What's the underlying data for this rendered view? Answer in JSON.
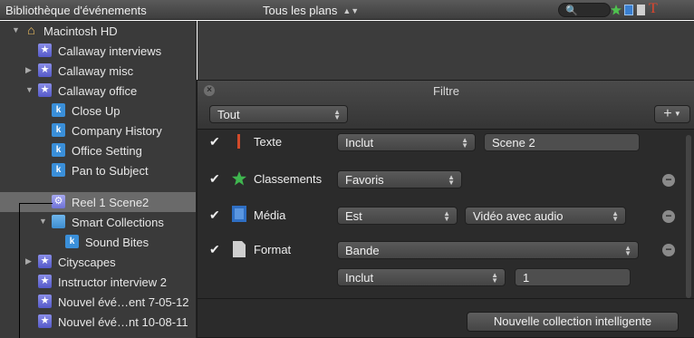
{
  "topbar": {
    "library_title": "Bibliothèque d'événements",
    "clip_filter": "Tous les plans"
  },
  "sidebar": {
    "items": [
      {
        "label": "Macintosh HD",
        "icon": "hard-drive-icon"
      },
      {
        "label": "Callaway interviews",
        "icon": "event-star-icon"
      },
      {
        "label": "Callaway misc",
        "icon": "event-star-icon"
      },
      {
        "label": "Callaway office",
        "icon": "event-star-icon"
      },
      {
        "label": "Close Up",
        "icon": "keyword-collection-icon"
      },
      {
        "label": "Company History",
        "icon": "keyword-collection-icon"
      },
      {
        "label": "Office Setting",
        "icon": "keyword-collection-icon"
      },
      {
        "label": "Pan to Subject",
        "icon": "keyword-collection-icon"
      },
      {
        "label": "Reel 1 Scene2",
        "icon": "smart-collection-icon"
      },
      {
        "label": "Smart Collections",
        "icon": "folder-icon"
      },
      {
        "label": "Sound Bites",
        "icon": "keyword-collection-icon"
      },
      {
        "label": "Cityscapes",
        "icon": "event-star-icon"
      },
      {
        "label": "Instructor interview 2",
        "icon": "event-star-icon"
      },
      {
        "label": "Nouvel évé…ent 7-05-12",
        "icon": "event-star-icon"
      },
      {
        "label": "Nouvel évé…nt 10-08-11",
        "icon": "event-star-icon"
      }
    ]
  },
  "filter": {
    "title": "Filtre",
    "match": "Tout",
    "rules": [
      {
        "label": "Texte",
        "operator": "Inclut",
        "value": "Scene 2"
      },
      {
        "label": "Classements",
        "operator": "Favoris"
      },
      {
        "label": "Média",
        "operator": "Est",
        "value": "Vidéo avec audio"
      },
      {
        "label": "Format",
        "operator": "Bande",
        "sub_operator": "Inclut",
        "sub_value": "1"
      }
    ],
    "new_button": "Nouvelle collection intelligente"
  },
  "colors": {
    "panel_bg": "#2b2b2b",
    "sidebar_bg": "#3a3a3a",
    "selection": "#6a6a6a",
    "accent_star": "#5559c9"
  }
}
